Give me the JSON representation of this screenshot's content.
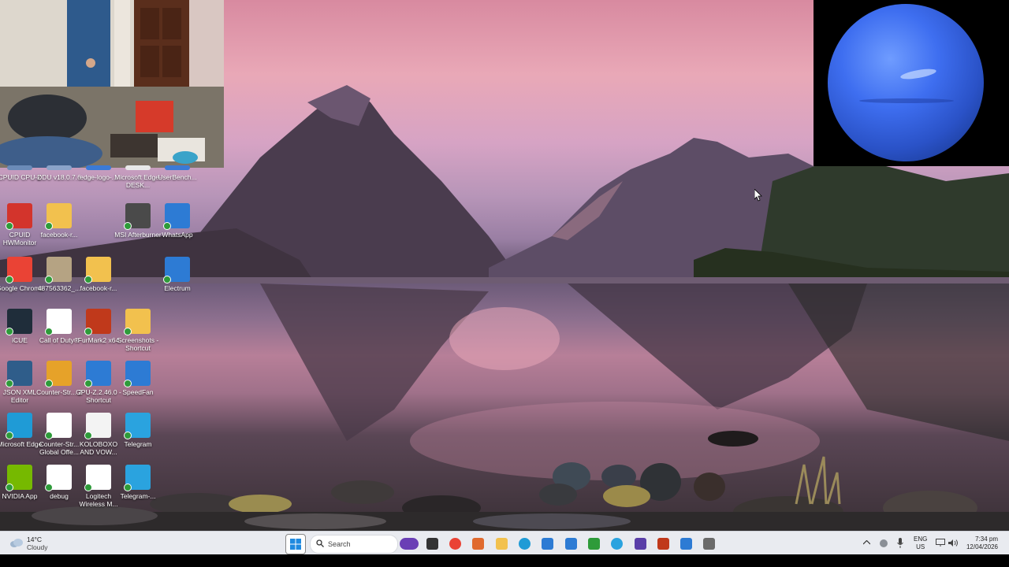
{
  "desktop_icons": [
    {
      "label": "CPUID CPU-Z",
      "color": "#6b8bb8"
    },
    {
      "label": "DDU v18.0.7.6",
      "color": "#8aa3c9"
    },
    {
      "label": "edge-logo-...",
      "color": "#3b7ad6"
    },
    {
      "label": "Microsoft Edge-DESK...",
      "color": "#e8e8e8"
    },
    {
      "label": "UserBench...",
      "color": "#3b7ad6"
    },
    {
      "label": "CPUID HWMonitor",
      "color": "#d3342c"
    },
    {
      "label": "facebook-r...",
      "color": "#f2c14e"
    },
    {
      "label": "MSI Afterburner",
      "color": "#4a4a4a"
    },
    {
      "label": "WhatsApp",
      "color": "#2d7bd4"
    },
    {
      "label": "Google Chrome",
      "color": "#ea4335"
    },
    {
      "label": "487563362_...",
      "color": "#b5a383"
    },
    {
      "label": "facebook-r...",
      "color": "#f2c14e"
    },
    {
      "label": "Electrum",
      "color": "#2d7bd4"
    },
    {
      "label": "iCUE",
      "color": "#1f2d3a"
    },
    {
      "label": "Call of Duty®",
      "color": "#ffffff"
    },
    {
      "label": "FurMark2 x64",
      "color": "#c0391b"
    },
    {
      "label": "Screenshots - Shortcut",
      "color": "#f2c14e"
    },
    {
      "label": "JSON XML Editor",
      "color": "#2f5d8a"
    },
    {
      "label": "Counter-Str... 2",
      "color": "#e6a229"
    },
    {
      "label": "GPU-Z.2.46.0 - Shortcut",
      "color": "#2d7bd4"
    },
    {
      "label": "SpeedFan",
      "color": "#2d7bd4"
    },
    {
      "label": "Microsoft Edge",
      "color": "#1f9bd6"
    },
    {
      "label": "Counter-Str... Global Offe...",
      "color": "#ffffff"
    },
    {
      "label": "KOLOBOXO AND VOW...",
      "color": "#f3f3f3"
    },
    {
      "label": "Telegram",
      "color": "#2aa3df"
    },
    {
      "label": "NVIDIA App",
      "color": "#76b900"
    },
    {
      "label": "debug",
      "color": "#ffffff"
    },
    {
      "label": "Logitech Wireless M...",
      "color": "#ffffff"
    },
    {
      "label": "Telegram-...",
      "color": "#2aa3df"
    }
  ],
  "taskbar": {
    "weather": {
      "temp": "14°C",
      "condition": "Cloudy"
    },
    "search_placeholder": "Search",
    "apps": [
      {
        "name": "widget-icon",
        "color": "#6a3fb5"
      },
      {
        "name": "task-view-icon",
        "color": "#333333"
      },
      {
        "name": "chrome-icon",
        "color": "#ea4335"
      },
      {
        "name": "app-icon",
        "color": "#e06a2e"
      },
      {
        "name": "file-explorer-icon",
        "color": "#f2c14e"
      },
      {
        "name": "edge-icon",
        "color": "#1f9bd6"
      },
      {
        "name": "outlook-icon",
        "color": "#2d7bd4"
      },
      {
        "name": "store-icon",
        "color": "#2d7bd4"
      },
      {
        "name": "discord-icon",
        "color": "#2e9b3a"
      },
      {
        "name": "telegram-icon",
        "color": "#2aa3df"
      },
      {
        "name": "app2-icon",
        "color": "#5a3fa8"
      },
      {
        "name": "furmark-icon",
        "color": "#c0391b"
      },
      {
        "name": "app3-icon",
        "color": "#2d7bd4"
      },
      {
        "name": "settings-icon",
        "color": "#6a6a6a"
      }
    ],
    "language": "ENG",
    "region": "US",
    "time": "7:34 pm",
    "date": "12/04/2026"
  }
}
